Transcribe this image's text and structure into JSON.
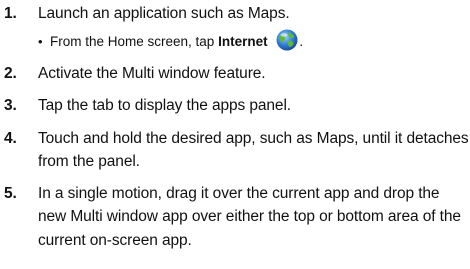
{
  "steps": [
    {
      "number": "1.",
      "text": "Launch an application such as Maps."
    },
    {
      "number": "2.",
      "text": "Activate the Multi window feature."
    },
    {
      "number": "3.",
      "text": "Tap the tab to display the apps panel."
    },
    {
      "number": "4.",
      "text": "Touch and hold the desired app, such as Maps, until it detaches from the panel."
    },
    {
      "number": "5.",
      "text": "In a single motion, drag it over the current app and drop the new Multi window app over either the top or bottom area of the current on-screen app."
    }
  ],
  "substep": {
    "bullet": "•",
    "prefix": "From the Home screen, tap",
    "bold": "Internet",
    "suffix": ".",
    "icon": "internet-globe-icon"
  },
  "colors": {
    "globe_blue": "#2f7fd6",
    "globe_green": "#5fb83a",
    "text": "#111111"
  }
}
